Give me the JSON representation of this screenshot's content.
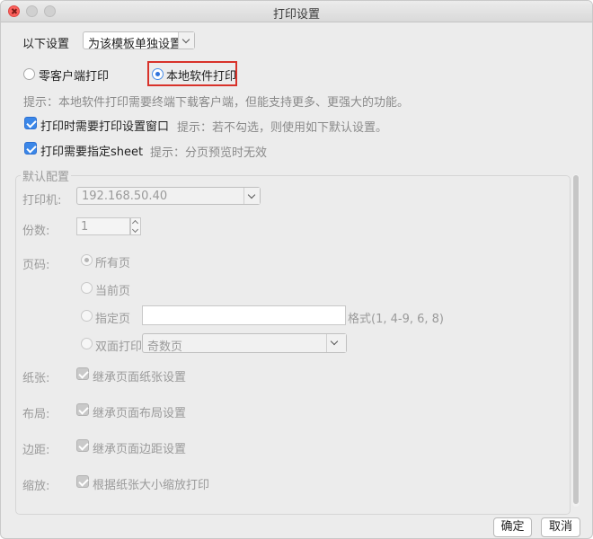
{
  "window": {
    "title": "打印设置"
  },
  "scope": {
    "label": "以下设置",
    "value": "为该模板单独设置"
  },
  "mode": {
    "zero_client": "零客户端打印",
    "local_software": "本地软件打印",
    "hint": "提示：本地软件打印需要终端下载客户端，但能支持更多、更强大的功能。"
  },
  "options": {
    "need_dialog": "打印时需要打印设置窗口",
    "need_dialog_hint": "提示：若不勾选，则使用如下默认设置。",
    "need_sheet": "打印需要指定sheet",
    "need_sheet_hint": "提示：分页预览时无效"
  },
  "defaults": {
    "legend": "默认配置",
    "printer_label": "打印机:",
    "printer_value": "192.168.50.40",
    "copies_label": "份数:",
    "copies_value": "1",
    "page_label": "页码:",
    "page_all": "所有页",
    "page_current": "当前页",
    "page_specified": "指定页",
    "page_format": "格式(1, 4-9, 6, 8)",
    "duplex": "双面打印",
    "duplex_value": "奇数页",
    "paper_label": "纸张:",
    "paper_inherit": "继承页面纸张设置",
    "layout_label": "布局:",
    "layout_inherit": "继承页面布局设置",
    "margin_label": "边距:",
    "margin_inherit": "继承页面边距设置",
    "zoom_label": "缩放:",
    "zoom_fit": "根据纸张大小缩放打印"
  },
  "buttons": {
    "ok": "确定",
    "cancel": "取消"
  }
}
